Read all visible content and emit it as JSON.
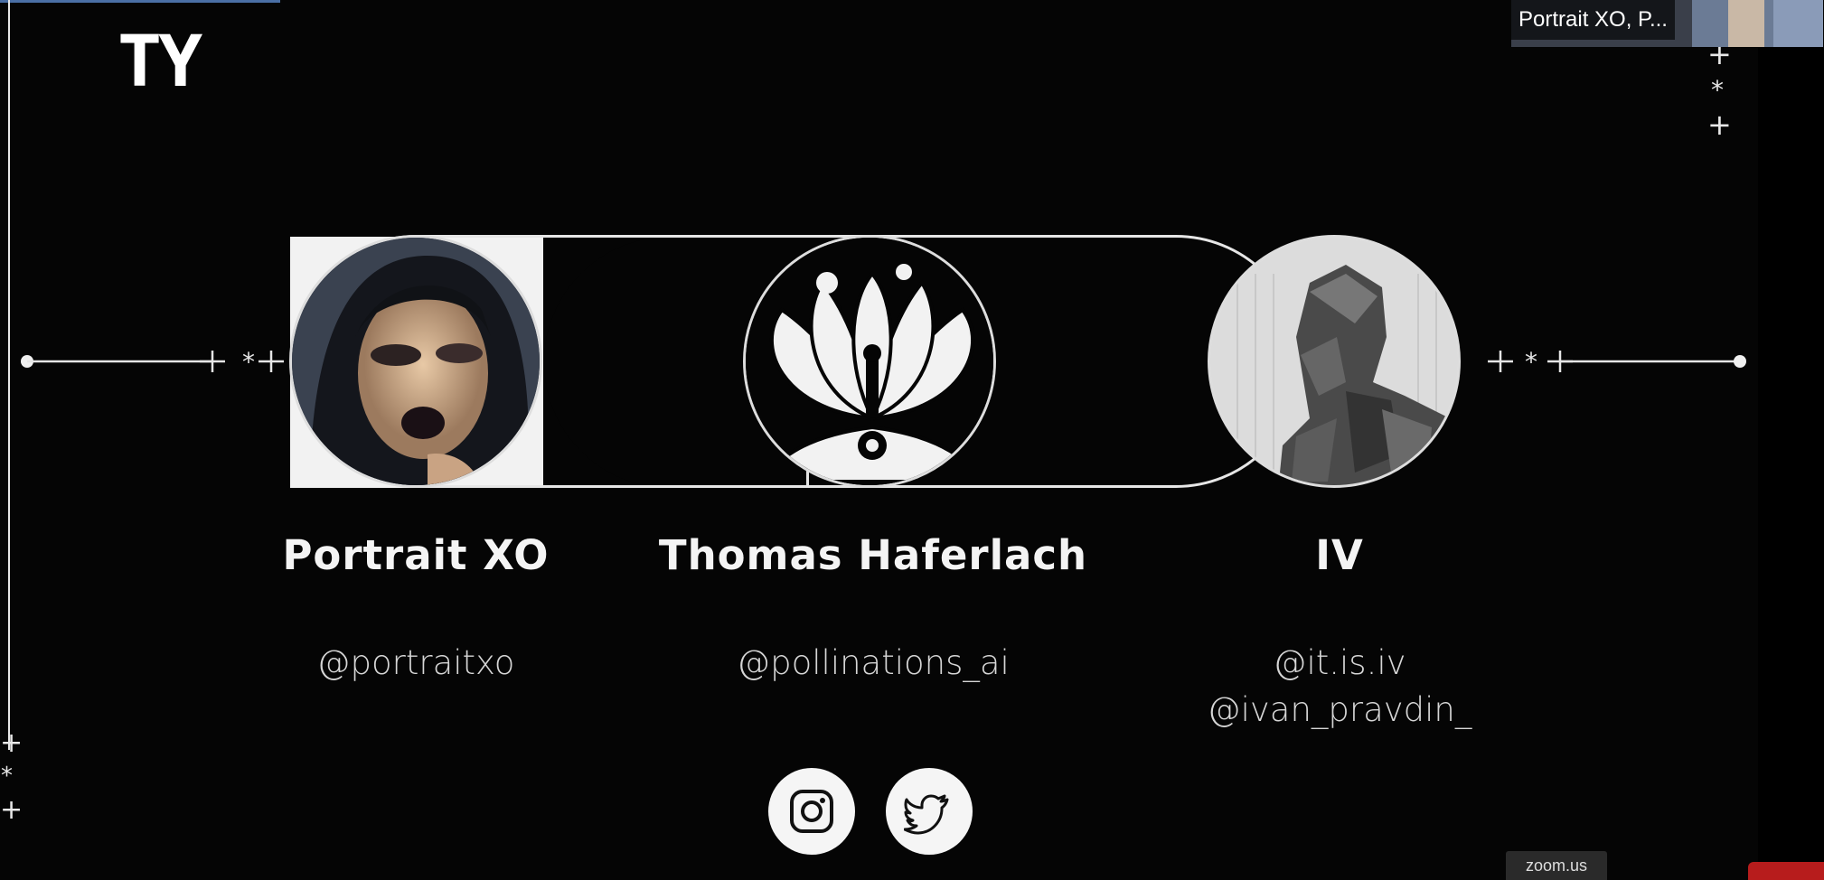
{
  "slide": {
    "logo": "TY",
    "people": [
      {
        "name": "Portrait XO",
        "handles": [
          "@portraitxo"
        ]
      },
      {
        "name": "Thomas Haferlach",
        "handles": [
          "@pollinations_ai"
        ]
      },
      {
        "name": "IV",
        "handles": [
          "@it.is.iv",
          "@ivan_pravdin_"
        ]
      }
    ],
    "social_icons": [
      "instagram-icon",
      "twitter-icon"
    ]
  },
  "zoom": {
    "participant_label": "Portrait XO, P...",
    "watermark": "zoom.us"
  },
  "colors": {
    "background": "#050505",
    "line": "#e6e6e6",
    "text": "#f4f4f4"
  }
}
